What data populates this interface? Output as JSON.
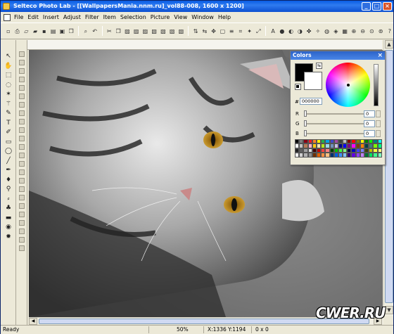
{
  "window": {
    "title": "Selteco Photo Lab - [[WallpapersMania.nnm.ru]_vol88-008, 1600 x 1200]"
  },
  "menu": [
    "File",
    "Edit",
    "Insert",
    "Adjust",
    "Filter",
    "Item",
    "Selection",
    "Picture",
    "View",
    "Window",
    "Help"
  ],
  "toolbar_icons": [
    "new-icon",
    "print-icon",
    "open-icon",
    "folder-icon",
    "save-icon",
    "scan-icon",
    "capture-icon",
    "copy-icon",
    "find-icon",
    "undo-icon",
    "cut-icon",
    "copy-icon",
    "paste-icon",
    "paste-icon",
    "paste-icon",
    "image-icon",
    "image-icon",
    "image-icon",
    "image-icon",
    "flip-v-icon",
    "flip-h-icon",
    "move-icon",
    "frame-icon",
    "layers-icon",
    "crop-icon",
    "stamp-icon",
    "resize-icon",
    "text-icon",
    "circle-icon",
    "contrast-icon",
    "invert-icon",
    "color-icon",
    "effects-icon",
    "tone-icon",
    "sharpen-icon",
    "gradient-icon",
    "zoom-in-icon",
    "zoom-out-icon",
    "zoom-fit-icon",
    "zoom-actual-icon",
    "help-icon"
  ],
  "left_tools": [
    "pointer-icon",
    "hand-icon",
    "marquee-icon",
    "lasso-icon",
    "magic-icon",
    "wand-icon",
    "brush-icon",
    "text-icon",
    "pencil-icon",
    "rect-icon",
    "ellipse-icon",
    "line-icon",
    "pen-icon",
    "bucket-icon",
    "zoom-icon",
    "eyedropper-icon",
    "stamp-icon",
    "eraser-icon",
    "redeye-icon",
    "sun-icon"
  ],
  "colors_panel": {
    "title": "Colors",
    "close": "×",
    "hex_label": "#",
    "hex_value": "000000",
    "channels": [
      {
        "label": "R",
        "value": "0"
      },
      {
        "label": "G",
        "value": "0"
      },
      {
        "label": "B",
        "value": "0"
      }
    ],
    "foreground": "#000000",
    "background": "#ffffff",
    "palette": [
      "#000000",
      "#7f7f7f",
      "#880015",
      "#ed1c24",
      "#ff7f27",
      "#fff200",
      "#22b14c",
      "#00a2e8",
      "#3f48cc",
      "#a349a4",
      "#404040",
      "#c0c0c0",
      "#800000",
      "#ff0000",
      "#808000",
      "#ffff00",
      "#008000",
      "#00ff00",
      "#008080",
      "#00ffff",
      "#ffffff",
      "#c3c3c3",
      "#b97a57",
      "#ffaec9",
      "#ffc90e",
      "#efe4b0",
      "#b5e61d",
      "#99d9ea",
      "#7092be",
      "#c8bfe7",
      "#000080",
      "#0000ff",
      "#800080",
      "#ff00ff",
      "#804000",
      "#ff8000",
      "#004040",
      "#408080",
      "#80ff00",
      "#00ff80",
      "#202020",
      "#606060",
      "#a0a0a0",
      "#e0e0e0",
      "#400000",
      "#c00000",
      "#ff4040",
      "#ff8080",
      "#004000",
      "#00c000",
      "#40ff40",
      "#80ff80",
      "#000040",
      "#0000c0",
      "#4040ff",
      "#8080ff",
      "#404000",
      "#c0c000",
      "#ffff40",
      "#ffff80",
      "#f0f0f0",
      "#d0d0d0",
      "#b0b0b0",
      "#909090",
      "#703000",
      "#e06000",
      "#ff9040",
      "#ffc080",
      "#003070",
      "#0060e0",
      "#4090ff",
      "#80c0ff",
      "#300070",
      "#6000e0",
      "#9040ff",
      "#c080ff",
      "#007030",
      "#00e060",
      "#40ff90",
      "#80ffc0"
    ]
  },
  "status": {
    "ready": "Ready",
    "zoom": "50%",
    "coords": "X:1336 Y:1194",
    "selection": "0 x 0"
  },
  "watermark": "CWER.RU"
}
